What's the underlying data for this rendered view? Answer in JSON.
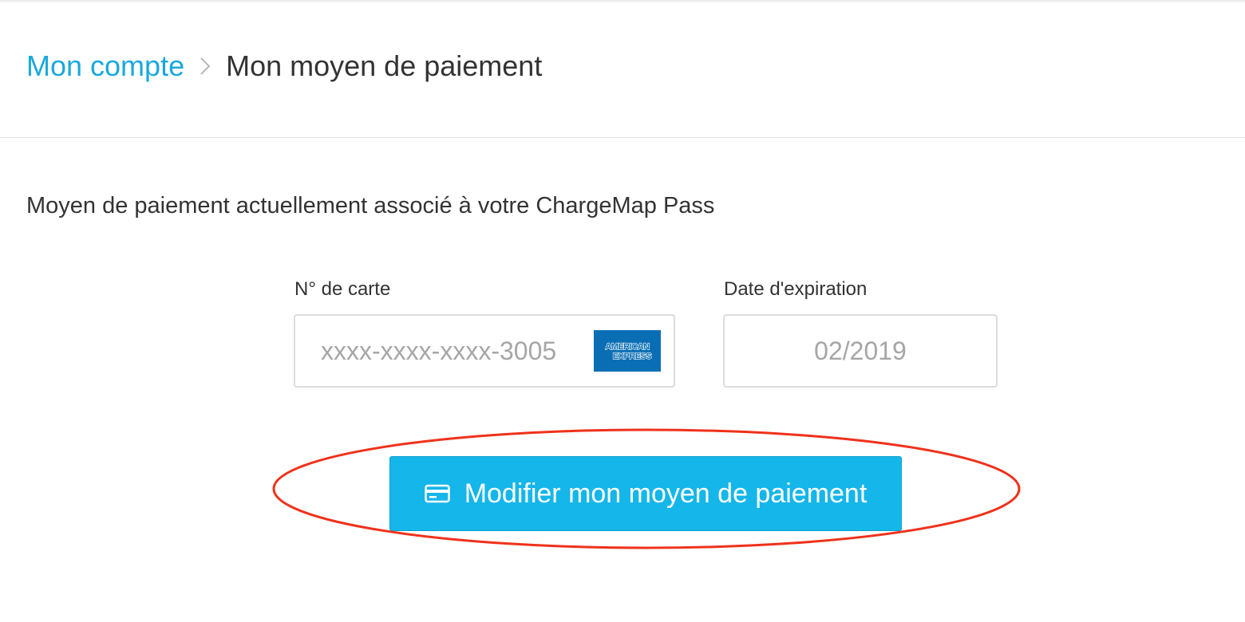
{
  "colors": {
    "accent": "#1aa8dc",
    "button": "#15b6ea",
    "annotation": "#f0311a",
    "amex": "#0a6eb4"
  },
  "breadcrumb": {
    "parent": "Mon compte",
    "separator_icon": "chevron-right-icon",
    "current": "Mon moyen de paiement"
  },
  "section": {
    "title": "Moyen de paiement actuellement associé à votre ChargeMap Pass"
  },
  "card": {
    "label": "N° de carte",
    "value": "xxxx-xxxx-xxxx-3005",
    "brand_logo": "american-express-logo",
    "brand_text_line1": "AMERICAN",
    "brand_text_line2": "EXPRESS"
  },
  "expiration": {
    "label": "Date d'expiration",
    "value": "02/2019"
  },
  "action": {
    "icon": "credit-card-icon",
    "label": "Modifier mon moyen de paiement"
  }
}
